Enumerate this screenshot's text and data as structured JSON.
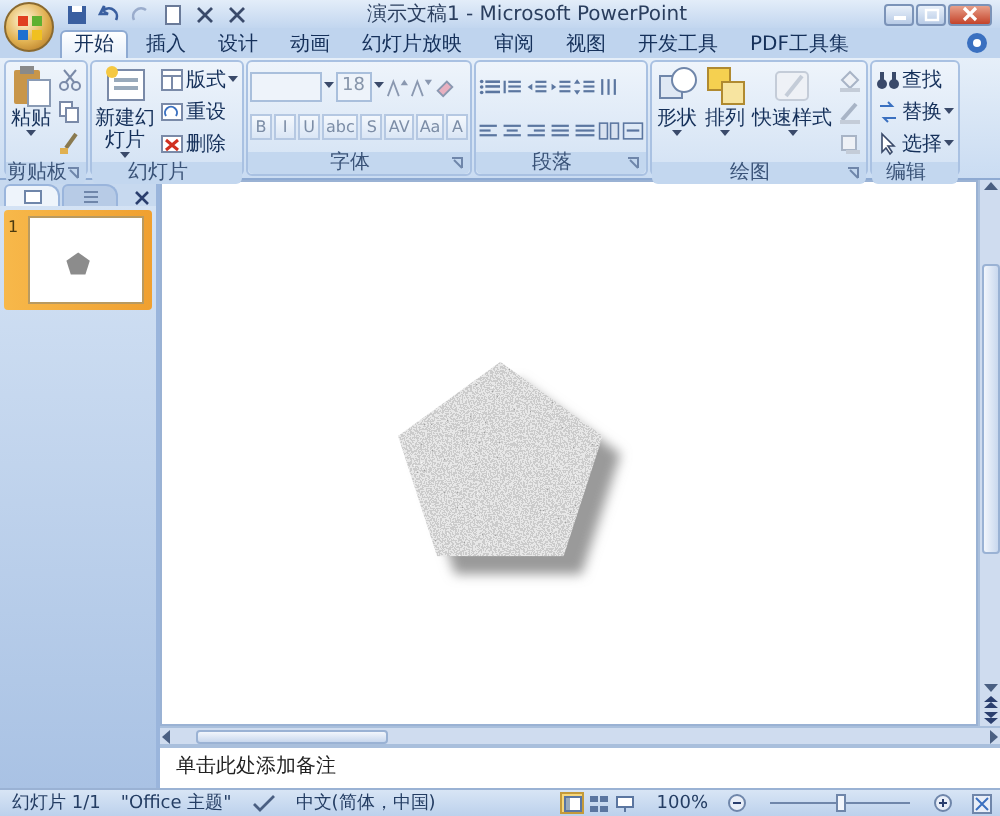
{
  "window": {
    "title": "演示文稿1 - Microsoft PowerPoint"
  },
  "ribbon_tabs": [
    {
      "label": "开始",
      "selected": true
    },
    {
      "label": "插入",
      "selected": false
    },
    {
      "label": "设计",
      "selected": false
    },
    {
      "label": "动画",
      "selected": false
    },
    {
      "label": "幻灯片放映",
      "selected": false
    },
    {
      "label": "审阅",
      "selected": false
    },
    {
      "label": "视图",
      "selected": false
    },
    {
      "label": "开发工具",
      "selected": false
    },
    {
      "label": "PDF工具集",
      "selected": false
    }
  ],
  "ribbon_groups": [
    {
      "label": "剪贴板",
      "launcher": true,
      "columns": [
        [
          {
            "kind": "large",
            "label": "粘贴",
            "dropdown": true
          }
        ],
        [
          {
            "kind": "icon"
          },
          {
            "kind": "icon"
          },
          {
            "kind": "icon"
          }
        ]
      ]
    },
    {
      "label": "幻灯片",
      "launcher": false,
      "columns": [
        [
          {
            "kind": "large",
            "label": "新建幻灯片",
            "dropdown": true
          }
        ],
        [
          {
            "kind": "small",
            "label": "版式",
            "dropdown": true
          },
          {
            "kind": "small",
            "label": "重设",
            "dropdown": false
          },
          {
            "kind": "small",
            "label": "删除",
            "dropdown": false
          }
        ]
      ]
    },
    {
      "label": "字体",
      "launcher": true,
      "lines": [
        [
          {
            "kind": "field"
          },
          {
            "kind": "field",
            "value": "18"
          },
          {
            "kind": "icon"
          },
          {
            "kind": "icon"
          },
          {
            "kind": "icon"
          }
        ],
        [
          {
            "kind": "text",
            "label": "B"
          },
          {
            "kind": "text",
            "label": "I"
          },
          {
            "kind": "text",
            "label": "U"
          },
          {
            "kind": "text",
            "label": "abc"
          },
          {
            "kind": "text",
            "label": "S"
          },
          {
            "kind": "text",
            "label": "AV"
          },
          {
            "kind": "text",
            "label": "Aa"
          },
          {
            "kind": "text",
            "label": "A"
          }
        ]
      ]
    },
    {
      "label": "段落",
      "launcher": true,
      "lines": [
        [
          {
            "kind": "icon"
          },
          {
            "kind": "icon"
          },
          {
            "kind": "icon"
          },
          {
            "kind": "icon"
          },
          {
            "kind": "icon"
          },
          {
            "kind": "icon"
          }
        ],
        [
          {
            "kind": "icon"
          },
          {
            "kind": "icon"
          },
          {
            "kind": "icon"
          },
          {
            "kind": "icon"
          },
          {
            "kind": "icon"
          },
          {
            "kind": "icon"
          },
          {
            "kind": "icon"
          }
        ]
      ]
    },
    {
      "label": "绘图",
      "launcher": true,
      "columns": [
        [
          {
            "kind": "large",
            "label": "形状",
            "dropdown": true
          }
        ],
        [
          {
            "kind": "large",
            "label": "排列",
            "dropdown": true
          }
        ],
        [
          {
            "kind": "large",
            "label": "快速样式",
            "dropdown": true
          }
        ],
        [
          {
            "kind": "icon"
          },
          {
            "kind": "icon"
          },
          {
            "kind": "icon"
          }
        ]
      ]
    },
    {
      "label": "编辑",
      "launcher": false,
      "columns": [
        [
          {
            "kind": "small",
            "label": "查找",
            "dropdown": false
          },
          {
            "kind": "small",
            "label": "替换",
            "dropdown": true
          },
          {
            "kind": "small",
            "label": "选择",
            "dropdown": true
          }
        ]
      ]
    }
  ],
  "slides_pane": {
    "tabs": [
      {
        "selected": true
      },
      {
        "selected": false
      }
    ],
    "slides": [
      {
        "number": "1",
        "selected": true
      }
    ]
  },
  "slide": {
    "shapes": [
      {
        "kind": "pentagon"
      }
    ]
  },
  "notes": {
    "placeholder": "单击此处添加备注"
  },
  "status_bar": {
    "slide": "幻灯片 1/1",
    "theme": "\"Office 主题\"",
    "language": "中文(简体，中国)",
    "views": [
      {
        "selected": true
      },
      {
        "selected": false
      },
      {
        "selected": false
      }
    ],
    "zoom": "100%",
    "zoom_slider": {
      "level": 0.5
    }
  }
}
